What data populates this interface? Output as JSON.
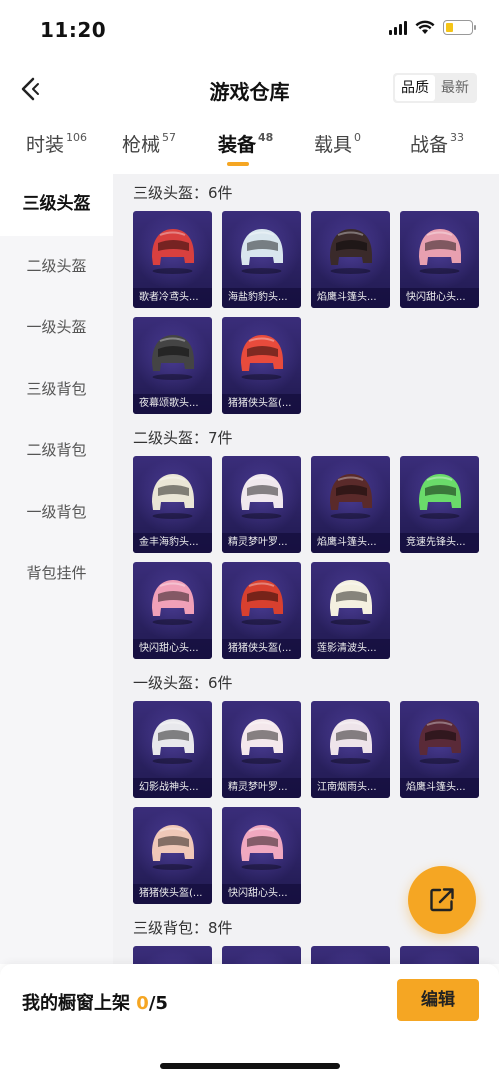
{
  "status_bar": {
    "time": "11:20"
  },
  "header": {
    "title": "游戏仓库",
    "sort_options": [
      "品质",
      "最新"
    ]
  },
  "tabs": [
    {
      "label": "时装",
      "count": "106"
    },
    {
      "label": "枪械",
      "count": "57"
    },
    {
      "label": "装备",
      "count": "48"
    },
    {
      "label": "载具",
      "count": "0"
    },
    {
      "label": "战备",
      "count": "33"
    }
  ],
  "sidebar": {
    "items": [
      {
        "label": "三级头盔"
      },
      {
        "label": "二级头盔"
      },
      {
        "label": "一级头盔"
      },
      {
        "label": "三级背包"
      },
      {
        "label": "二级背包"
      },
      {
        "label": "一级背包"
      },
      {
        "label": "背包挂件"
      }
    ]
  },
  "sections": [
    {
      "title": "三级头盔：6件",
      "items": [
        {
          "label": "歌者冷鸢头...",
          "color": "#d8403f"
        },
        {
          "label": "海盐豹豹头...",
          "color": "#d9e6ee"
        },
        {
          "label": "焰鹰斗篷头...",
          "color": "#3a2a2a"
        },
        {
          "label": "快闪甜心头...",
          "color": "#e8a0b0"
        },
        {
          "label": "夜幕颂歌头...",
          "color": "#444444"
        },
        {
          "label": "猪猪侠头盔(...",
          "color": "#e84b3c"
        }
      ]
    },
    {
      "title": "二级头盔：7件",
      "items": [
        {
          "label": "金丰海豹头...",
          "color": "#eae6d6"
        },
        {
          "label": "精灵梦叶罗...",
          "color": "#f0e8ee"
        },
        {
          "label": "焰鹰斗篷头...",
          "color": "#5a2a2a"
        },
        {
          "label": "竞速先锋头...",
          "color": "#6adb6a"
        },
        {
          "label": "快闪甜心头...",
          "color": "#f0a0b8"
        },
        {
          "label": "猪猪侠头盔(...",
          "color": "#d8402f"
        },
        {
          "label": "莲影清波头...",
          "color": "#f4f0e0"
        }
      ]
    },
    {
      "title": "一级头盔：6件",
      "items": [
        {
          "label": "幻影战神头...",
          "color": "#e8e8ec"
        },
        {
          "label": "精灵梦叶罗...",
          "color": "#f4e8ec"
        },
        {
          "label": "江南烟雨头...",
          "color": "#eee4ea"
        },
        {
          "label": "焰鹰斗篷头...",
          "color": "#5a2a38"
        },
        {
          "label": "猪猪侠头盔(...",
          "color": "#f0c8b8"
        },
        {
          "label": "快闪甜心头...",
          "color": "#f0a8c0"
        }
      ]
    },
    {
      "title": "三级背包：8件",
      "items": []
    }
  ],
  "bottom_bar": {
    "shelf_label": "我的橱窗上架 ",
    "shelf_count": "0",
    "shelf_total": "/5",
    "edit_label": "编辑"
  },
  "colors": {
    "accent": "#f5a623",
    "card_bg": "#2a2160"
  }
}
